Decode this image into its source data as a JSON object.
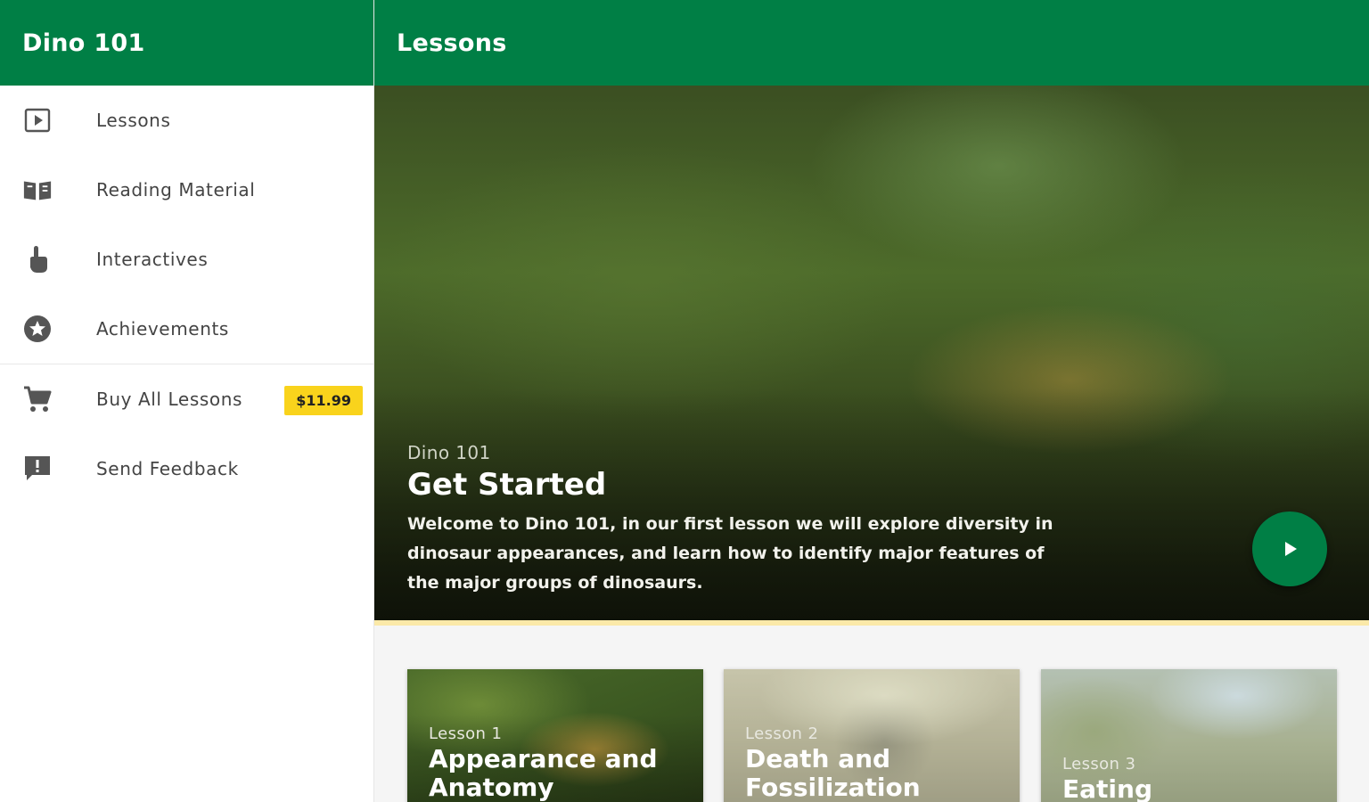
{
  "sidebar": {
    "title": "Dino 101",
    "items": [
      {
        "label": "Lessons",
        "icon": "play-box-icon"
      },
      {
        "label": "Reading Material",
        "icon": "book-icon"
      },
      {
        "label": "Interactives",
        "icon": "hand-pointer-icon"
      },
      {
        "label": "Achievements",
        "icon": "star-badge-icon"
      },
      {
        "label": "Buy All Lessons",
        "icon": "cart-icon",
        "badge": "$11.99"
      },
      {
        "label": "Send Feedback",
        "icon": "feedback-icon"
      }
    ]
  },
  "topbar": {
    "title": "Lessons"
  },
  "hero": {
    "kicker": "Dino 101",
    "title": "Get Started",
    "description": "Welcome to Dino 101, in our first lesson we will explore diversity in dinosaur appearances, and learn how to identify major features of the major groups of dinosaurs."
  },
  "lessons": [
    {
      "kicker": "Lesson 1",
      "title": "Appearance and Anatomy"
    },
    {
      "kicker": "Lesson 2",
      "title": "Death and Fossilization"
    },
    {
      "kicker": "Lesson 3",
      "title": "Eating"
    }
  ],
  "colors": {
    "primary": "#007f45",
    "badge": "#f9d31c",
    "icon": "#555555"
  }
}
